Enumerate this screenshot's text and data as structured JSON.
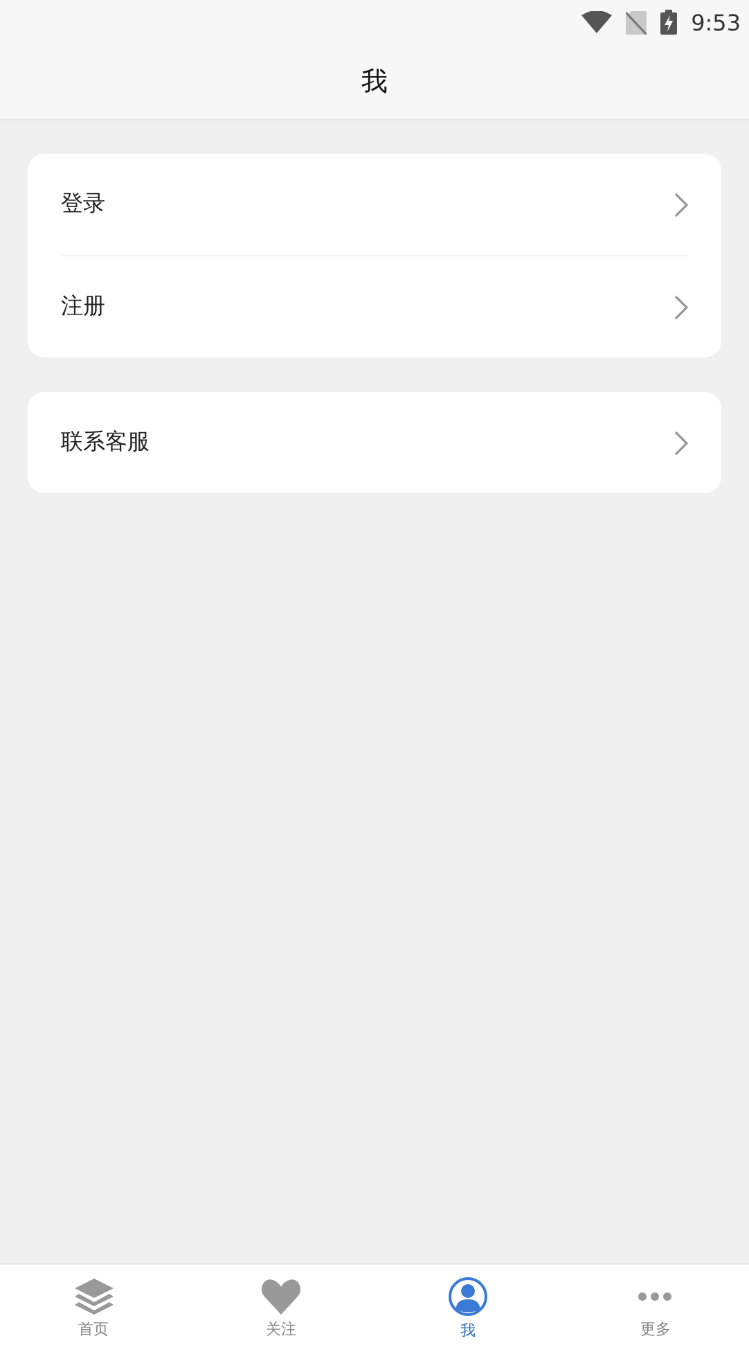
{
  "status_bar": {
    "time": "9:53"
  },
  "header": {
    "title": "我"
  },
  "groups": [
    {
      "items": [
        {
          "label": "登录"
        },
        {
          "label": "注册"
        }
      ]
    },
    {
      "items": [
        {
          "label": "联系客服"
        }
      ]
    }
  ],
  "tab_bar": [
    {
      "label": "首页",
      "kind": "layers",
      "selected": false
    },
    {
      "label": "关注",
      "kind": "heart",
      "selected": false
    },
    {
      "label": "我",
      "kind": "person",
      "selected": true
    },
    {
      "label": "更多",
      "kind": "more",
      "selected": false
    }
  ]
}
